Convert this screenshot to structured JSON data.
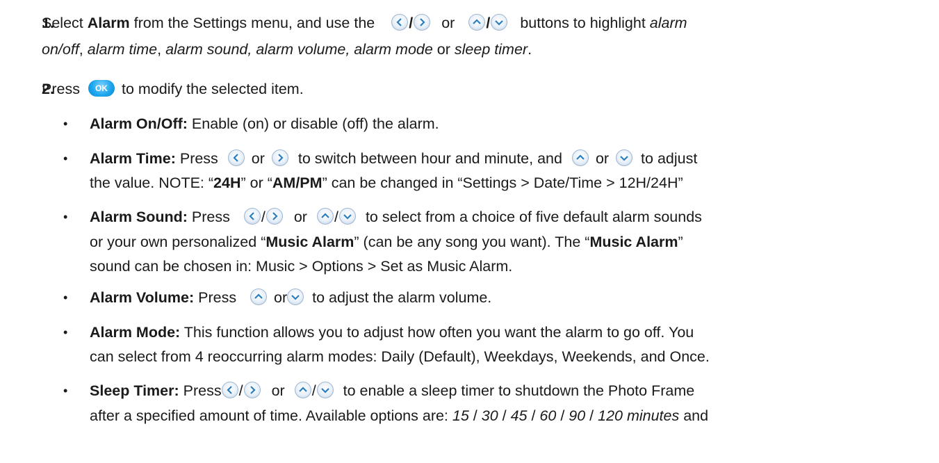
{
  "steps": [
    {
      "number": "1.",
      "line1": {
        "a": "Select ",
        "b_alarm": "Alarm",
        "c": " from the Settings menu, and use the",
        "slash1": "/",
        "or": "or",
        "slash2": "/",
        "d": "buttons to highlight ",
        "e_alarm": "alarm"
      },
      "line2": {
        "a_on_off": "on/off",
        "comma1": ", ",
        "b_time": "alarm time",
        "comma2": ", ",
        "c_rest": "alarm sound, alarm volume, alarm mode",
        "or": " or ",
        "d_sleep": "sleep timer",
        "period": "."
      }
    },
    {
      "number": "2.",
      "line1": {
        "a": "Press",
        "ok_label": "OK",
        "b": "to modify the selected item."
      }
    }
  ],
  "bullets": [
    {
      "dot": "•",
      "lines": [
        {
          "label": "Alarm On/Off:",
          "text": " Enable (on) or disable (off) the alarm."
        }
      ]
    },
    {
      "dot": "•",
      "line1": {
        "label": "Alarm Time:",
        "a": " Press",
        "or1": "or",
        "b": "to switch between hour and minute, and",
        "or2": "or",
        "c": "to adjust"
      },
      "line2": {
        "a": "the value. NOTE: “",
        "b_24h": "24H",
        "c": "” or “",
        "d_ampm": "AM/PM",
        "e": "” can be changed in “Settings > Date/Time > 12H/24H”"
      }
    },
    {
      "dot": "•",
      "line1": {
        "label": "Alarm Sound:",
        "a": " Press",
        "slash1": "/",
        "or": "or",
        "slash2": "/",
        "b": "to select from a choice of five default alarm sounds"
      },
      "line2": {
        "a": "or your own personalized “",
        "b_music": "Music Alarm",
        "c": "” (can be any song you want). The “",
        "d_music": "Music Alarm",
        "e": "”"
      },
      "line3": {
        "a": "sound can be chosen in: Music > Options > Set as Music Alarm."
      }
    },
    {
      "dot": "•",
      "line1": {
        "label": "Alarm Volume:",
        "a": " Press",
        "or": "or",
        "b": "to adjust the alarm volume."
      }
    },
    {
      "dot": "•",
      "line1": {
        "label": "Alarm Mode:",
        "a": " This function allows you to adjust how often you want the alarm to go off. You"
      },
      "line2": {
        "a": "can select from 4 reoccurring alarm modes: Daily (Default), Weekdays, Weekends, and Once."
      }
    },
    {
      "dot": "•",
      "line1": {
        "label": "Sleep Timer:",
        "a": " Press",
        "slash1": "/",
        "or": "or",
        "slash2": "/",
        "b": "to enable a sleep timer to shutdown the Photo Frame"
      },
      "line2": {
        "a": "after a specified amount of time. Available options are: ",
        "o15": "15",
        "s1": " / ",
        "o30": "30",
        "s2": " / ",
        "o45": "45",
        "s3": " / ",
        "o60": "60",
        "s4": " / ",
        "o90": "90",
        "s5": " / ",
        "o120": "120 minutes",
        "end": " and"
      }
    }
  ],
  "icons": {
    "left": "left-arrow-button-icon",
    "right": "right-arrow-button-icon",
    "up": "up-arrow-button-icon",
    "down": "down-arrow-button-icon",
    "ok": "ok-button-icon"
  },
  "colors": {
    "button_blue": "#1ea7ee",
    "arrow": "#2b7fc0",
    "text": "#1a1a1a"
  }
}
